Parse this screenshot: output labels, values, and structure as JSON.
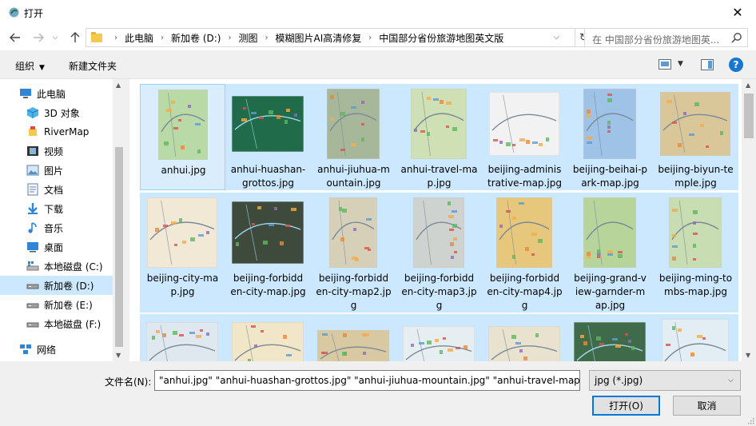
{
  "window": {
    "title": "打开"
  },
  "address": {
    "crumbs": [
      "此电脑",
      "新加卷 (D:)",
      "测图",
      "模糊图片AI高清修复",
      "中国部分省份旅游地图英文版"
    ]
  },
  "search": {
    "placeholder": "在 中国部分省份旅游地图英..."
  },
  "toolbar": {
    "organize": "组织",
    "new_folder": "新建文件夹"
  },
  "nav": {
    "items": [
      {
        "label": "此电脑",
        "icon": "computer-icon"
      },
      {
        "label": "3D 对象",
        "icon": "3d-objects-icon"
      },
      {
        "label": "RiverMap",
        "icon": "rivermap-icon"
      },
      {
        "label": "视频",
        "icon": "video-icon"
      },
      {
        "label": "图片",
        "icon": "pictures-icon"
      },
      {
        "label": "文档",
        "icon": "documents-icon"
      },
      {
        "label": "下载",
        "icon": "downloads-icon"
      },
      {
        "label": "音乐",
        "icon": "music-icon"
      },
      {
        "label": "桌面",
        "icon": "desktop-icon"
      },
      {
        "label": "本地磁盘 (C:)",
        "icon": "drive-c-icon"
      },
      {
        "label": "新加卷 (D:)",
        "icon": "drive-d-icon"
      },
      {
        "label": "新加卷 (E:)",
        "icon": "drive-e-icon"
      },
      {
        "label": "本地磁盘 (F:)",
        "icon": "drive-f-icon"
      },
      {
        "label": "网络",
        "icon": "network-icon"
      }
    ],
    "selected_index": 10
  },
  "files": [
    {
      "name": "anhui.jpg",
      "theme": "#b9d9a6"
    },
    {
      "name": "anhui-huashan-grottos.jpg",
      "theme": "#1f6b4a"
    },
    {
      "name": "anhui-jiuhua-mountain.jpg",
      "theme": "#a7b89a"
    },
    {
      "name": "anhui-travel-map.jpg",
      "theme": "#cfe0b5"
    },
    {
      "name": "beijing-administrative-map.jpg",
      "theme": "#f2f2f2"
    },
    {
      "name": "beijing-beihai-park-map.jpg",
      "theme": "#9fc3e6"
    },
    {
      "name": "beijing-biyun-temple.jpg",
      "theme": "#d9c79a"
    },
    {
      "name": "beijing-city-map.jpg",
      "theme": "#f1e9d6"
    },
    {
      "name": "beijing-forbidden-city-map.jpg",
      "theme": "#3d4a3c"
    },
    {
      "name": "beijing-forbidden-city-map2.jpg",
      "theme": "#d6d0b8"
    },
    {
      "name": "beijing-forbidden-city-map3.jpg",
      "theme": "#cfd3cf"
    },
    {
      "name": "beijing-forbidden-city-map4.jpg",
      "theme": "#e7c77c"
    },
    {
      "name": "beijing-grand-view-garnder-map.jpg",
      "theme": "#b7d49b"
    },
    {
      "name": "beijing-ming-tombs-map.jpg",
      "theme": "#c9ddb2"
    },
    {
      "name": "",
      "theme": "#dfe8ef"
    },
    {
      "name": "",
      "theme": "#f1e7c8"
    },
    {
      "name": "",
      "theme": "#d9c9a3"
    },
    {
      "name": "",
      "theme": "#e7eef2"
    },
    {
      "name": "",
      "theme": "#e9e2cf"
    },
    {
      "name": "",
      "theme": "#3f6b4a"
    },
    {
      "name": "",
      "theme": "#e3eef4"
    }
  ],
  "labels": [
    [
      "anhui.jpg"
    ],
    [
      "anhui-huashan-",
      "grottos.jpg"
    ],
    [
      "anhui-jiuhua-m",
      "ountain.jpg"
    ],
    [
      "anhui-travel-ma",
      "p.jpg"
    ],
    [
      "beijing-adminis",
      "trative-map.jpg"
    ],
    [
      "beijing-beihai-p",
      "ark-map.jpg"
    ],
    [
      "beijing-biyun-te",
      "mple.jpg"
    ],
    [
      "beijing-city-ma",
      "p.jpg"
    ],
    [
      "beijing-forbidd",
      "en-city-map.jpg"
    ],
    [
      "beijing-forbidd",
      "en-city-map2.jp",
      "g"
    ],
    [
      "beijing-forbidd",
      "en-city-map3.jp",
      "g"
    ],
    [
      "beijing-forbidd",
      "en-city-map4.jp",
      "g"
    ],
    [
      "beijing-grand-v",
      "iew-garnder-m",
      "ap.jpg"
    ],
    [
      "beijing-ming-to",
      "mbs-map.jpg"
    ],
    [],
    [],
    [],
    [],
    [],
    [],
    []
  ],
  "footer": {
    "filename_label": "文件名(N):",
    "filename_value": "\"anhui.jpg\" \"anhui-huashan-grottos.jpg\" \"anhui-jiuhua-mountain.jpg\" \"anhui-travel-map.jpg\"",
    "filetype": "jpg (*.jpg)",
    "open": "打开(O)",
    "cancel": "取消"
  },
  "colors": {
    "selection": "#cce8ff",
    "accent": "#0078d7"
  }
}
